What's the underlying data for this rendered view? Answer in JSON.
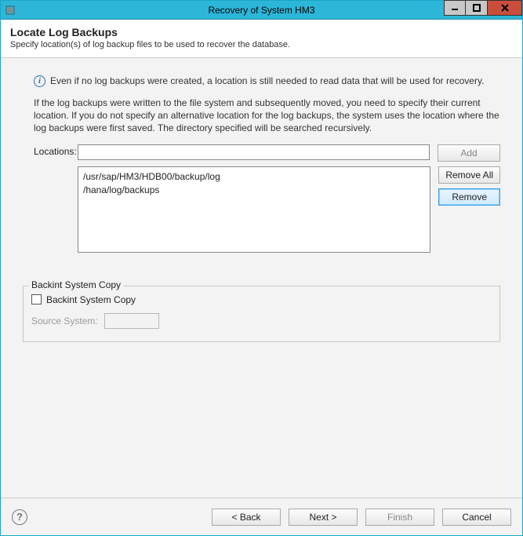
{
  "window": {
    "title": "Recovery of System HM3"
  },
  "header": {
    "title": "Locate Log Backups",
    "subtitle": "Specify location(s) of log backup files to be used to recover the database."
  },
  "info": "Even if no log backups were created, a location is still needed to read data that will be used for recovery.",
  "paragraph": "If the log backups were written to the file system and subsequently moved, you need to specify their current location. If you do not specify an alternative location for the log backups, the system uses the location where the log backups were first saved. The directory specified will be searched recursively.",
  "locations": {
    "label": "Locations:",
    "input": "",
    "add": "Add",
    "removeAll": "Remove All",
    "remove": "Remove",
    "items": [
      "/usr/sap/HM3/HDB00/backup/log",
      "/hana/log/backups"
    ]
  },
  "backint": {
    "groupTitle": "Backint System Copy",
    "checkboxLabel": "Backint System Copy",
    "sourceLabel": "Source System:",
    "sourceValue": ""
  },
  "nav": {
    "back": "< Back",
    "next": "Next >",
    "finish": "Finish",
    "cancel": "Cancel"
  }
}
